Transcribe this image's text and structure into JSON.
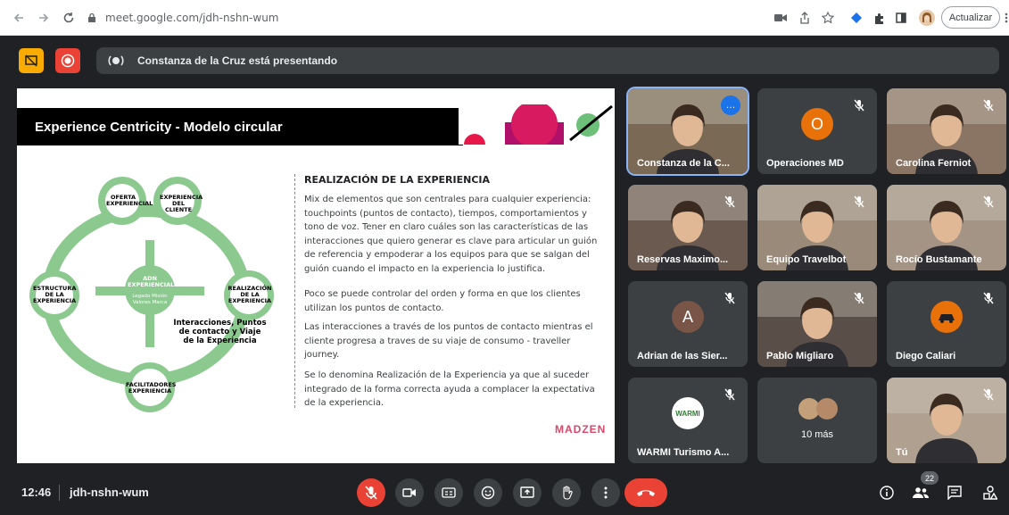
{
  "browser": {
    "url": "meet.google.com/jdh-nshn-wum",
    "update_label": "Actualizar"
  },
  "topbar": {
    "presenting_text": "Constanza de la Cruz está presentando"
  },
  "slide": {
    "title": "Experience Centricity - Modelo circular",
    "heading": "REALIZACIÓN DE LA EXPERIENCIA",
    "paragraphs": [
      "Mix de elementos que son centrales para cualquier experiencia: touchpoints (puntos de contacto), tiempos, comportamientos y tono de voz. Tener en claro cuáles son las características de las interacciones que quiero generar es clave para articular un guión de referencia y empoderar a los equipos para que se salgan del guión cuando el impacto en la experiencia lo justifica.",
      "Poco se puede controlar del orden y forma en que los clientes utilizan los puntos de contacto.",
      "Las interacciones a través de los puntos de contacto mientras el cliente progresa a traves de su viaje de consumo - traveller journey.",
      "Se lo denomina Realización de la Experiencia ya que al suceder integrado de la forma correcta ayuda a complacer la expectativa de la experiencia."
    ],
    "brand": "MADZEN",
    "diagram": {
      "oferta": "OFERTA EXPERIENCIAL",
      "experiencia_cliente": "EXPERIENCIA DEL CLIENTE",
      "estructura": "ESTRUCTURA DE LA EXPERIENCIA",
      "realizacion": "REALIZACIÓN DE LA EXPERIENCIA",
      "facilitadores": "FACILITADORES EXPERIENCIA",
      "adn": "ADN EXPERIENCIAL",
      "adn_sub": "Legado Misión Valores Marca",
      "caption": "Interacciones, Puntos de contacto y Viaje de la Experiencia"
    }
  },
  "participants": [
    {
      "name": "Constanza de la C...",
      "type": "video",
      "tone": "#7a6a55"
    },
    {
      "name": "Operaciones MD",
      "type": "avatar",
      "initial": "O",
      "color": "#e8710a"
    },
    {
      "name": "Carolina Ferniot",
      "type": "video",
      "tone": "#8a7565"
    },
    {
      "name": "Reservas Maximo...",
      "type": "video",
      "tone": "#6b5a50"
    },
    {
      "name": "Equipo Travelbot",
      "type": "video",
      "tone": "#9a8a7a"
    },
    {
      "name": "Rocío Bustamante",
      "type": "video",
      "tone": "#a49485"
    },
    {
      "name": "Adrian de las Sier...",
      "type": "avatar",
      "initial": "A",
      "color": "#795548"
    },
    {
      "name": "Pablo Migliaro",
      "type": "video",
      "tone": "#5a4f48"
    },
    {
      "name": "Diego Caliari",
      "type": "logo"
    },
    {
      "name": "WARMI Turismo A...",
      "type": "logo_warmi",
      "logo_text": "WARMI"
    },
    {
      "name": "10 más",
      "type": "more"
    },
    {
      "name": "Tú",
      "type": "video",
      "tone": "#b0a090"
    }
  ],
  "bottombar": {
    "time": "12:46",
    "meeting_code": "jdh-nshn-wum",
    "participant_count": "22"
  }
}
